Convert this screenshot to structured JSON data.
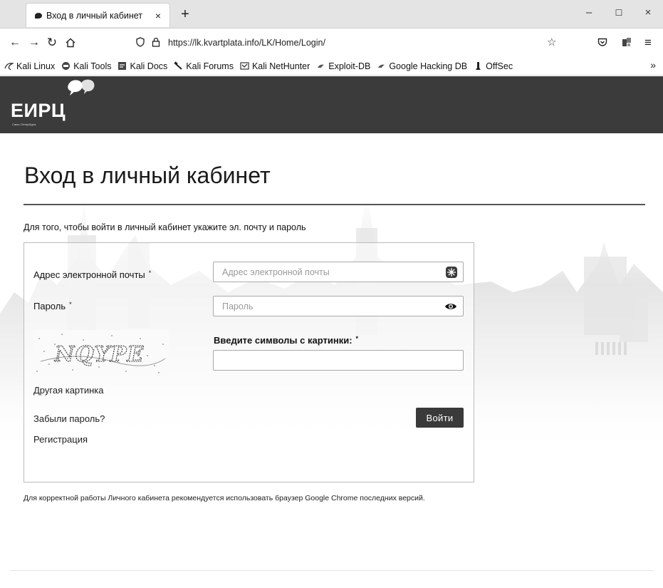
{
  "browser": {
    "tab_title": "Вход в личный кабинет",
    "tab_close": "×",
    "new_tab": "+",
    "url": "https://lk.kvartplata.info/LK/Home/Login/",
    "window_controls": {
      "minimize": "–",
      "maximize": "☐",
      "close": "×"
    },
    "nav_icons": [
      "back-arrow-icon",
      "forward-arrow-icon",
      "reload-icon",
      "home-icon",
      "shield-icon",
      "lock-icon",
      "star-icon",
      "pocket-icon",
      "extensions-icon",
      "menu-icon"
    ],
    "bookmarks": [
      {
        "label": "Kali Linux",
        "icon": "kali-dragon-icon"
      },
      {
        "label": "Kali Tools",
        "icon": "kali-tools-icon"
      },
      {
        "label": "Kali Docs",
        "icon": "kali-docs-icon"
      },
      {
        "label": "Kali Forums",
        "icon": "kali-forums-icon"
      },
      {
        "label": "Kali NetHunter",
        "icon": "nethunter-icon"
      },
      {
        "label": "Exploit-DB",
        "icon": "exploit-db-icon"
      },
      {
        "label": "Google Hacking DB",
        "icon": "ghdb-icon"
      },
      {
        "label": "OffSec",
        "icon": "offsec-icon"
      }
    ],
    "bookmarks_more": "»"
  },
  "site": {
    "logo": "ЕИРЦ",
    "logo_sub": "Санкт-Петербурга"
  },
  "page": {
    "title": "Вход в личный кабинет",
    "intro": "Для того, чтобы войти в личный кабинет укажите эл. почту и пароль",
    "email_label": "Адрес электронной почты",
    "email_placeholder": "Адрес электронной почты",
    "password_label": "Пароль",
    "password_placeholder": "Пароль",
    "required_mark": "*",
    "captcha_text": "NQYPE",
    "captcha_label": "Введите символы с картинки:",
    "captcha_refresh": "Другая картинка",
    "forgot_password": "Забыли пароль?",
    "register": "Регистрация",
    "login_button": "Войти",
    "browser_note": "Для корректной работы Личного кабинета рекомендуется использовать браузер Google Chrome последних версий."
  }
}
